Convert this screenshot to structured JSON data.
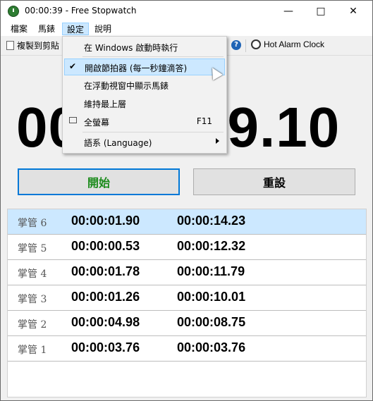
{
  "window": {
    "title": "00:00:39 - Free Stopwatch"
  },
  "menubar": {
    "items": [
      "檔案",
      "馬錶",
      "設定",
      "說明"
    ]
  },
  "toolbar": {
    "copy_label": "複製到剪貼",
    "alarm_label": "Hot Alarm Clock"
  },
  "display": {
    "time_visible_left": "00",
    "time_visible_right": "39.10"
  },
  "buttons": {
    "start": "開始",
    "reset": "重設"
  },
  "laps": [
    {
      "name": "掌管 6",
      "lap": "00:00:01.90",
      "total": "00:00:14.23",
      "selected": true
    },
    {
      "name": "掌管 5",
      "lap": "00:00:00.53",
      "total": "00:00:12.32"
    },
    {
      "name": "掌管 4",
      "lap": "00:00:01.78",
      "total": "00:00:11.79"
    },
    {
      "name": "掌管 3",
      "lap": "00:00:01.26",
      "total": "00:00:10.01"
    },
    {
      "name": "掌管 2",
      "lap": "00:00:04.98",
      "total": "00:00:08.75"
    },
    {
      "name": "掌管 1",
      "lap": "00:00:03.76",
      "total": "00:00:03.76"
    }
  ],
  "settings_menu": {
    "items": [
      {
        "label": "在 Windows 啟動時執行"
      },
      {
        "label": "開啟節拍器 (每一秒鐘滴答)",
        "checked": true
      },
      {
        "label": "在浮動視窗中顯示馬錶"
      },
      {
        "label": "維持最上層"
      },
      {
        "label": "全螢幕",
        "shortcut": "F11"
      },
      {
        "label": "語系 (Language)"
      }
    ]
  },
  "colors": {
    "accent": "#0078d7",
    "start_text": "#1a8a1a",
    "selected_row": "#cce8ff"
  }
}
